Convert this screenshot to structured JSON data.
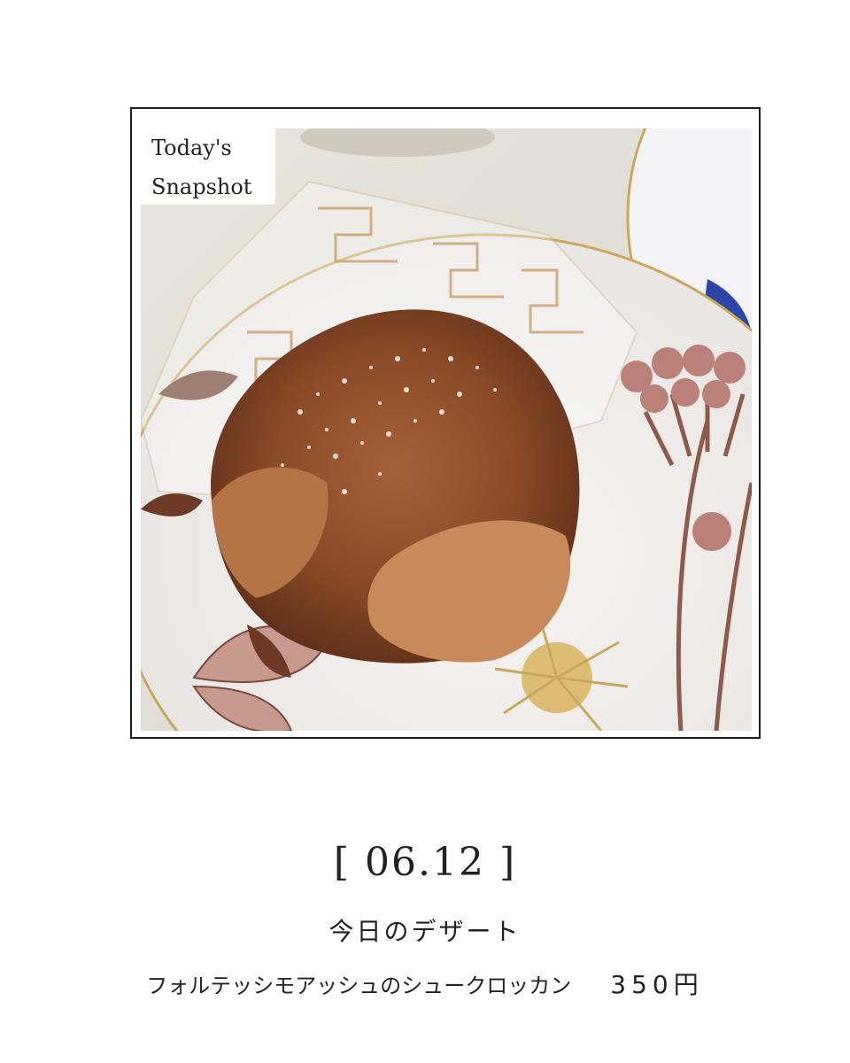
{
  "snapshot": {
    "label_line1": "Today's",
    "label_line2": "Snapshot"
  },
  "photo": {
    "icon": "cream-puff-photo"
  },
  "caption": {
    "date": "[ 06.12 ]",
    "title": "今日のデザート",
    "item_name": "フォルテッシモアッシュのシュークロッカン",
    "price": "350円"
  }
}
